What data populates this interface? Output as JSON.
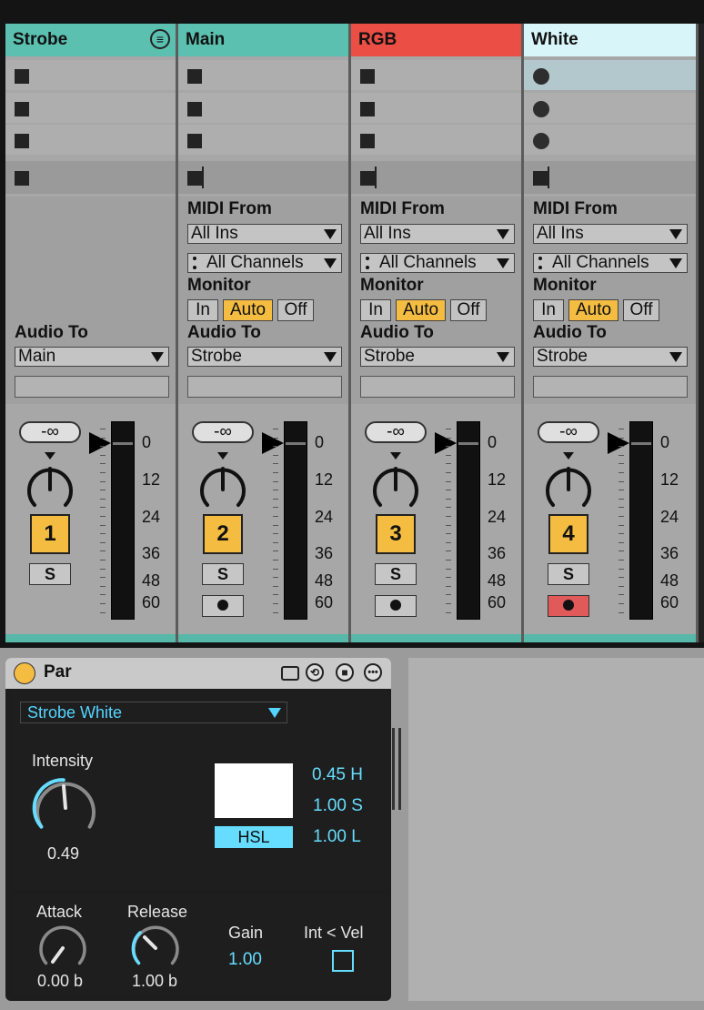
{
  "tracks": [
    {
      "name": "Strobe",
      "head_color": "#5bc0b0",
      "has_menu": true,
      "midi": false,
      "audio_to": "Main",
      "volume": "-∞",
      "number": "1",
      "solo": "S",
      "arm": false
    },
    {
      "name": "Main",
      "head_color": "#5bc0b0",
      "has_menu": false,
      "midi": true,
      "audio_to": "Strobe",
      "volume": "-∞",
      "number": "2",
      "solo": "S",
      "arm": false
    },
    {
      "name": "RGB",
      "head_color": "#ea4e44",
      "has_menu": false,
      "midi": true,
      "audio_to": "Strobe",
      "volume": "-∞",
      "number": "3",
      "solo": "S",
      "arm": false
    },
    {
      "name": "White",
      "head_color": "#d8f6fa",
      "has_menu": false,
      "midi": true,
      "audio_to": "Strobe",
      "volume": "-∞",
      "number": "4",
      "solo": "S",
      "arm": true
    }
  ],
  "io_labels": {
    "midi_from": "MIDI From",
    "all_ins": "All Ins",
    "all_channels": "All Channels",
    "monitor": "Monitor",
    "monitor_in": "In",
    "monitor_auto": "Auto",
    "monitor_off": "Off",
    "audio_to": "Audio To"
  },
  "db_scale": [
    "0",
    "12",
    "24",
    "36",
    "48",
    "60"
  ],
  "device": {
    "title": "Par",
    "preset": "Strobe White",
    "intensity_label": "Intensity",
    "intensity_value": "0.49",
    "hue": "0.45 H",
    "saturation": "1.00 S",
    "lightness": "1.00 L",
    "hsl_button": "HSL",
    "swatch_color": "#ffffff",
    "attack_label": "Attack",
    "attack_value": "0.00 b",
    "release_label": "Release",
    "release_value": "1.00 b",
    "gain_label": "Gain",
    "gain_value": "1.00",
    "intvel_label": "Int < Vel",
    "power_color": "#f4bd41",
    "accent": "#66ddff",
    "icons": [
      "clip-icon",
      "hot-swap-icon",
      "save-icon",
      "more-icon"
    ]
  }
}
